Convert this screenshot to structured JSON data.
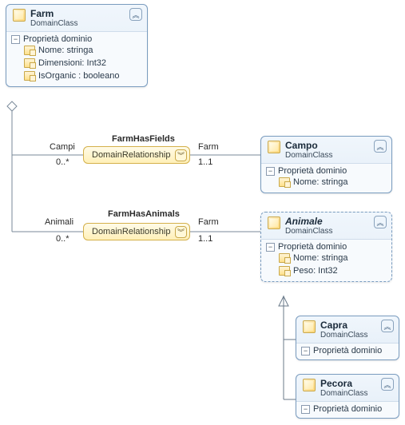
{
  "farm": {
    "name": "Farm",
    "sub": "DomainClass",
    "section": "Proprietà dominio",
    "props": [
      {
        "label": "Nome: stringa"
      },
      {
        "label": "Dimensioni: Int32"
      },
      {
        "label": "IsOrganic : booleano"
      }
    ]
  },
  "campo": {
    "name": "Campo",
    "sub": "DomainClass",
    "section": "Proprietà dominio",
    "props": [
      {
        "label": "Nome: stringa"
      }
    ]
  },
  "animale": {
    "name": "Animale",
    "sub": "DomainClass",
    "section": "Proprietà dominio",
    "props": [
      {
        "label": "Nome: stringa"
      },
      {
        "label": "Peso: Int32"
      }
    ]
  },
  "capra": {
    "name": "Capra",
    "sub": "DomainClass",
    "section": "Proprietà dominio"
  },
  "pecora": {
    "name": "Pecora",
    "sub": "DomainClass",
    "section": "Proprietà dominio"
  },
  "rel1": {
    "title": "FarmHasFields",
    "body": "DomainRelationship",
    "leftRole": "Campi",
    "leftMult": "0..*",
    "rightRole": "Farm",
    "rightMult": "1..1"
  },
  "rel2": {
    "title": "FarmHasAnimals",
    "body": "DomainRelationship",
    "leftRole": "Animali",
    "leftMult": "0..*",
    "rightRole": "Farm",
    "rightMult": "1..1"
  },
  "glyph": {
    "chevronUp": "︽",
    "chevronDown": "︾",
    "minus": "−"
  }
}
